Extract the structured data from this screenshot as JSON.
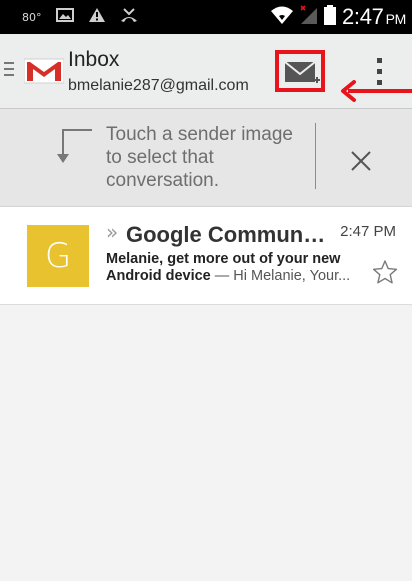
{
  "status_bar": {
    "temperature": "80°",
    "time": "2:47",
    "time_suffix": "PM",
    "icons": [
      "image-icon",
      "warning-icon",
      "missed-call-icon",
      "wifi-icon",
      "no-signal-icon",
      "battery-icon"
    ]
  },
  "header": {
    "title": "Inbox",
    "account": "bmelanie287@gmail.com",
    "icons": [
      "menu-icon",
      "gmail-logo",
      "compose-icon",
      "overflow-menu-icon"
    ],
    "highlight_color": "#e8131b"
  },
  "tip": {
    "text": "Touch a sender image to select that conversation.",
    "icons": [
      "corner-arrow-icon",
      "close-icon"
    ]
  },
  "conversations": [
    {
      "avatar_letter": "G",
      "avatar_color": "#e8c22f",
      "importance_marker": "»",
      "sender": "Google Communi...",
      "time": "2:47 PM",
      "subject_line1": "Melanie, get more out of your new",
      "subject_line2": "Android device",
      "snippet": " — Hi Melanie, Your...",
      "starred": false
    }
  ]
}
